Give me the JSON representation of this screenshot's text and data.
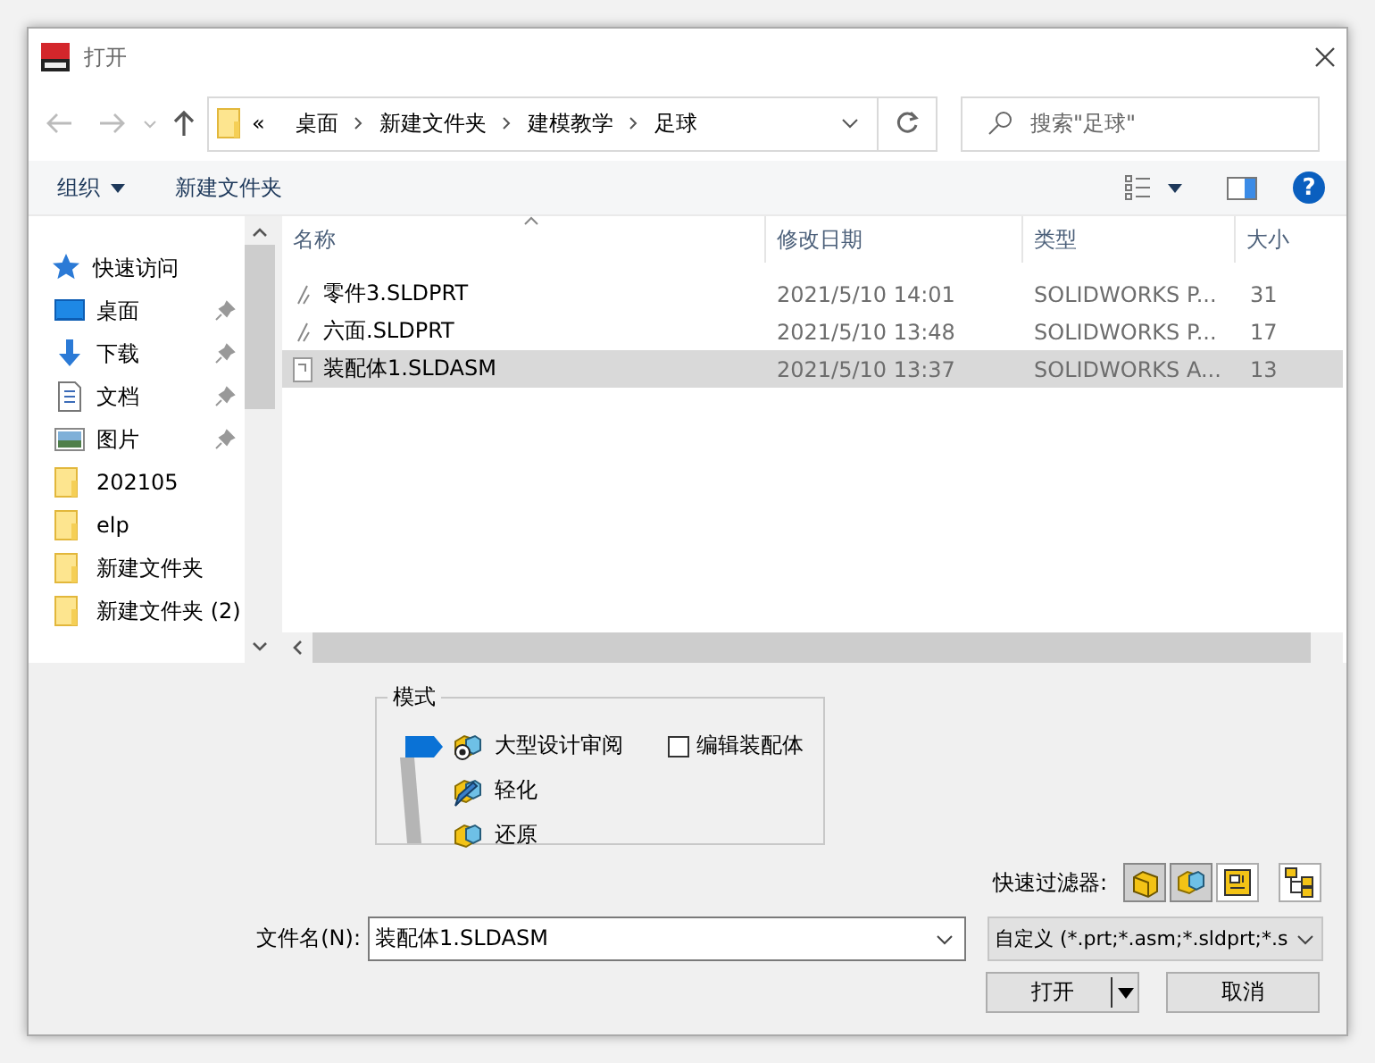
{
  "window": {
    "title": "打开"
  },
  "address": {
    "overflow": "«",
    "crumbs": [
      "桌面",
      "新建文件夹",
      "建模教学",
      "足球"
    ]
  },
  "search": {
    "placeholder": "搜索\"足球\""
  },
  "toolbar": {
    "organize": "组织",
    "new_folder": "新建文件夹",
    "help": "?"
  },
  "nav": [
    {
      "kind": "quick",
      "label": "快速访问",
      "pinned": false
    },
    {
      "kind": "desktop",
      "label": "桌面",
      "pinned": true
    },
    {
      "kind": "download",
      "label": "下载",
      "pinned": true
    },
    {
      "kind": "document",
      "label": "文档",
      "pinned": true
    },
    {
      "kind": "picture",
      "label": "图片",
      "pinned": true
    },
    {
      "kind": "folder",
      "label": "202105",
      "pinned": false
    },
    {
      "kind": "folder",
      "label": "elp",
      "pinned": false
    },
    {
      "kind": "folder",
      "label": "新建文件夹",
      "pinned": false
    },
    {
      "kind": "folder",
      "label": "新建文件夹 (2)",
      "pinned": false
    }
  ],
  "table": {
    "columns": [
      "名称",
      "修改日期",
      "类型",
      "大小"
    ],
    "rows": [
      {
        "kind": "part",
        "name": "零件3.SLDPRT",
        "date": "2021/5/10 14:01",
        "type": "SOLIDWORKS P...",
        "size": "31",
        "selected": false
      },
      {
        "kind": "part",
        "name": "六面.SLDPRT",
        "date": "2021/5/10 13:48",
        "type": "SOLIDWORKS P...",
        "size": "17",
        "selected": false
      },
      {
        "kind": "assembly",
        "name": "装配体1.SLDASM",
        "date": "2021/5/10 13:37",
        "type": "SOLIDWORKS A...",
        "size": "13",
        "selected": true
      }
    ]
  },
  "mode": {
    "title": "模式",
    "options": [
      {
        "label": "大型设计审阅",
        "selected": true
      },
      {
        "label": "轻化",
        "selected": false
      },
      {
        "label": "还原",
        "selected": false
      }
    ],
    "edit_assembly": {
      "label": "编辑装配体",
      "checked": false
    }
  },
  "quick_filter": {
    "label": "快速过滤器:",
    "buttons": [
      {
        "kind": "part",
        "pressed": true
      },
      {
        "kind": "assembly",
        "pressed": true
      },
      {
        "kind": "drawing",
        "pressed": false
      }
    ]
  },
  "filename": {
    "label": "文件名(N):",
    "value": "装配体1.SLDASM"
  },
  "filetype": {
    "value": "自定义 (*.prt;*.asm;*.sldprt;*.s"
  },
  "buttons": [
    "打开",
    "取消"
  ]
}
